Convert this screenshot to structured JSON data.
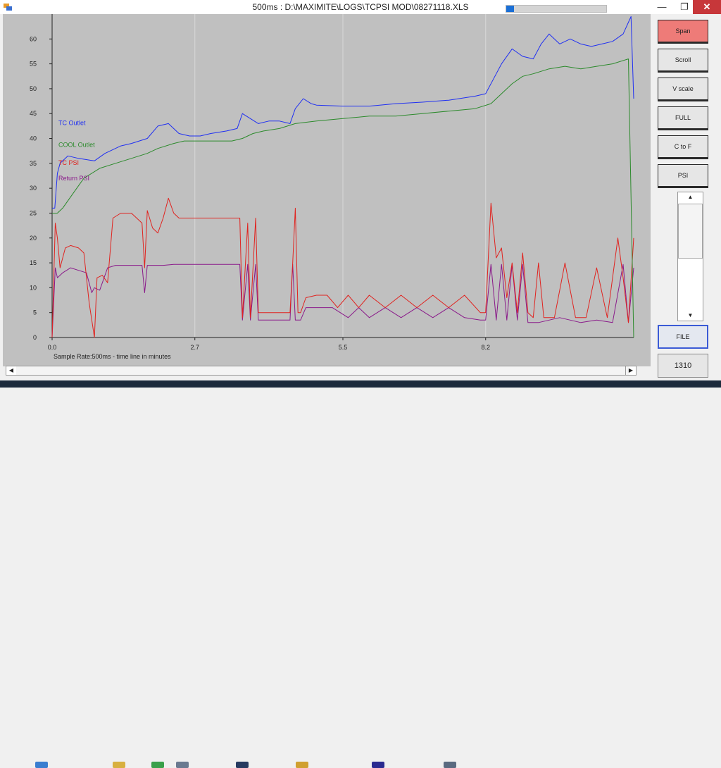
{
  "window": {
    "title": "500ms : D:\\MAXIMITE\\LOGS\\TCPSI MOD\\08271118.XLS",
    "progress_fraction": 0.08,
    "minimize_glyph": "—",
    "maximize_glyph": "❐",
    "close_glyph": "✕"
  },
  "sidebar": {
    "buttons": [
      {
        "label": "Span",
        "active": true
      },
      {
        "label": "Scroll",
        "active": false
      },
      {
        "label": "V scale",
        "active": false
      },
      {
        "label": "FULL",
        "active": false
      },
      {
        "label": "C to F",
        "active": false
      },
      {
        "label": "PSI",
        "active": false
      }
    ],
    "scroll_up_glyph": "▲",
    "scroll_down_glyph": "▼",
    "file_label": "FILE",
    "count_label": "1310"
  },
  "hscroll": {
    "left_glyph": "◀",
    "right_glyph": "▶"
  },
  "colors": {
    "plot_bg": "#c0c0c0",
    "grid": "#d8d8d8",
    "tc_outlet": "#1f2ff2",
    "cool_outlet": "#2c8a2c",
    "tc_psi": "#e0231f",
    "return_psi": "#8a1a8a",
    "axis_caption": "#2040d0"
  },
  "chart_data": {
    "type": "line",
    "caption": "Sample Rate:500ms - time line in minutes",
    "xlim": [
      0,
      11.0
    ],
    "ylim": [
      0,
      65
    ],
    "x_ticks": [
      "0.0",
      "2.7",
      "5.5",
      "8.2"
    ],
    "x_tick_values": [
      0,
      2.7,
      5.5,
      8.2
    ],
    "y_ticks": [
      0,
      5,
      10,
      15,
      20,
      25,
      30,
      35,
      40,
      45,
      50,
      55,
      60
    ],
    "series": [
      {
        "name": "TC Outlet",
        "color_key": "tc_outlet",
        "x": [
          0.0,
          0.05,
          0.1,
          0.15,
          0.3,
          0.5,
          0.8,
          1.0,
          1.3,
          1.5,
          1.8,
          2.0,
          2.2,
          2.4,
          2.6,
          2.8,
          3.0,
          3.3,
          3.5,
          3.6,
          3.75,
          3.9,
          4.1,
          4.3,
          4.5,
          4.6,
          4.75,
          4.9,
          5.0,
          5.5,
          6.0,
          6.5,
          7.0,
          7.5,
          8.0,
          8.2,
          8.35,
          8.5,
          8.7,
          8.9,
          9.1,
          9.25,
          9.4,
          9.6,
          9.8,
          10.0,
          10.2,
          10.4,
          10.6,
          10.8,
          10.95,
          11.0
        ],
        "y": [
          26,
          26,
          33,
          35,
          36.5,
          36,
          35.5,
          37,
          38.5,
          39,
          40,
          42.5,
          43,
          41,
          40.5,
          40.5,
          41,
          41.5,
          42,
          45,
          44,
          43,
          43.5,
          43.5,
          43,
          46,
          48,
          47,
          46.7,
          46.5,
          46.5,
          47,
          47.3,
          47.7,
          48.5,
          49,
          52,
          55,
          58,
          56.5,
          56,
          59,
          61,
          59,
          60,
          59,
          58.5,
          59,
          59.5,
          61,
          64.5,
          48
        ],
        "labelY": 42.7
      },
      {
        "name": "COOL Outlet",
        "color_key": "cool_outlet",
        "x": [
          0.0,
          0.1,
          0.2,
          0.4,
          0.6,
          0.9,
          1.2,
          1.5,
          1.8,
          2.0,
          2.3,
          2.5,
          2.8,
          3.1,
          3.4,
          3.6,
          3.8,
          4.0,
          4.3,
          4.6,
          5.0,
          5.5,
          6.0,
          6.5,
          7.0,
          7.5,
          8.0,
          8.3,
          8.5,
          8.7,
          8.9,
          9.1,
          9.4,
          9.7,
          10.0,
          10.3,
          10.6,
          10.9,
          11.0
        ],
        "y": [
          25,
          25,
          26,
          29,
          32,
          34,
          35,
          36,
          37,
          38,
          39,
          39.5,
          39.5,
          39.5,
          39.5,
          40,
          41,
          41.5,
          42,
          43,
          43.5,
          44,
          44.5,
          44.5,
          45,
          45.5,
          46,
          47,
          49,
          51,
          52.5,
          53,
          54,
          54.5,
          54,
          54.5,
          55,
          56,
          0
        ],
        "labelY": 38.3
      },
      {
        "name": "TC PSI",
        "color_key": "tc_psi",
        "x": [
          0.0,
          0.06,
          0.1,
          0.15,
          0.25,
          0.35,
          0.5,
          0.6,
          0.7,
          0.8,
          0.85,
          0.95,
          1.05,
          1.15,
          1.3,
          1.5,
          1.7,
          1.75,
          1.8,
          1.9,
          2.0,
          2.1,
          2.2,
          2.3,
          2.4,
          2.6,
          2.8,
          3.0,
          3.4,
          3.55,
          3.6,
          3.7,
          3.75,
          3.85,
          3.9,
          4.0,
          4.2,
          4.4,
          4.5,
          4.55,
          4.6,
          4.65,
          4.7,
          4.8,
          5.0,
          5.2,
          5.4,
          5.6,
          5.8,
          6.0,
          6.3,
          6.6,
          6.9,
          7.2,
          7.5,
          7.8,
          8.1,
          8.2,
          8.3,
          8.4,
          8.5,
          8.6,
          8.7,
          8.8,
          8.9,
          9.0,
          9.1,
          9.2,
          9.3,
          9.5,
          9.7,
          9.9,
          10.1,
          10.3,
          10.5,
          10.7,
          10.8,
          10.9,
          11.0
        ],
        "y": [
          0,
          23,
          20,
          14,
          18,
          18.5,
          18,
          17,
          7,
          0,
          12,
          12.5,
          11,
          24,
          25,
          25,
          23,
          14,
          25.5,
          22,
          21,
          24,
          28,
          25,
          24,
          24,
          24,
          24,
          24,
          24,
          4,
          23,
          4,
          24,
          5,
          5,
          5,
          5,
          5,
          15,
          26,
          5,
          5,
          8,
          8.5,
          8.5,
          6,
          8.5,
          6,
          8.5,
          6,
          8.5,
          6,
          8.5,
          6,
          8.5,
          5,
          5,
          27,
          16,
          18,
          8,
          15,
          5,
          17,
          5,
          4,
          15,
          4,
          4,
          15,
          4,
          4,
          14,
          4,
          20,
          12,
          3,
          20
        ],
        "labelY": 34.7
      },
      {
        "name": "Return PSI",
        "color_key": "return_psi",
        "x": [
          0.0,
          0.06,
          0.1,
          0.2,
          0.35,
          0.5,
          0.65,
          0.75,
          0.8,
          0.9,
          1.05,
          1.2,
          1.4,
          1.7,
          1.75,
          1.8,
          1.9,
          2.1,
          2.3,
          2.6,
          3.0,
          3.4,
          3.55,
          3.6,
          3.7,
          3.75,
          3.85,
          3.9,
          4.1,
          4.4,
          4.5,
          4.55,
          4.6,
          4.65,
          4.7,
          4.8,
          5.0,
          5.3,
          5.6,
          5.8,
          6.0,
          6.3,
          6.6,
          6.9,
          7.2,
          7.5,
          7.8,
          8.1,
          8.2,
          8.3,
          8.4,
          8.5,
          8.6,
          8.7,
          8.8,
          8.9,
          9.0,
          9.2,
          9.4,
          9.6,
          9.8,
          10.0,
          10.3,
          10.6,
          10.8,
          10.9,
          11.0
        ],
        "y": [
          0,
          14,
          12,
          13,
          14,
          13.5,
          13,
          9,
          10,
          9.5,
          14,
          14.5,
          14.5,
          14.5,
          9,
          14.5,
          14.5,
          14.5,
          14.7,
          14.7,
          14.7,
          14.7,
          14.7,
          3.5,
          14.7,
          3.5,
          14.7,
          3.5,
          3.5,
          3.5,
          3.5,
          14.7,
          3.5,
          3.5,
          3.5,
          6,
          6,
          6,
          4,
          6,
          4,
          6,
          4,
          6,
          4,
          6,
          4,
          3.5,
          3.5,
          14.7,
          3.5,
          14.7,
          3.5,
          14.7,
          3.5,
          14.7,
          3,
          3,
          3.5,
          4,
          3.5,
          3,
          3.5,
          3,
          14.7,
          3,
          14
        ],
        "labelY": 31.6
      }
    ]
  }
}
